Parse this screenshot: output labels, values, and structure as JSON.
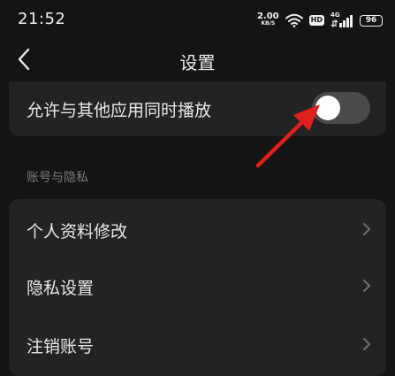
{
  "status_bar": {
    "time": "21:52",
    "net_speed_value": "2.00",
    "net_speed_unit": "KB/S",
    "hd_badge": "HD",
    "network_type": "4G",
    "battery": "96"
  },
  "header": {
    "title": "设置"
  },
  "settings": {
    "allow_background_play": {
      "label": "允许与其他应用同时播放",
      "enabled": false
    }
  },
  "account_section": {
    "label": "账号与隐私",
    "items": [
      {
        "label": "个人资料修改"
      },
      {
        "label": "隐私设置"
      },
      {
        "label": "注销账号"
      }
    ]
  },
  "colors": {
    "background": "#141414",
    "card": "#232323",
    "toggle_off": "#4a4a4a",
    "annotation_arrow": "#e0201b"
  },
  "icons": [
    "back-arrow-icon",
    "wifi-icon",
    "signal-icon",
    "battery-icon",
    "chevron-right-icon"
  ]
}
